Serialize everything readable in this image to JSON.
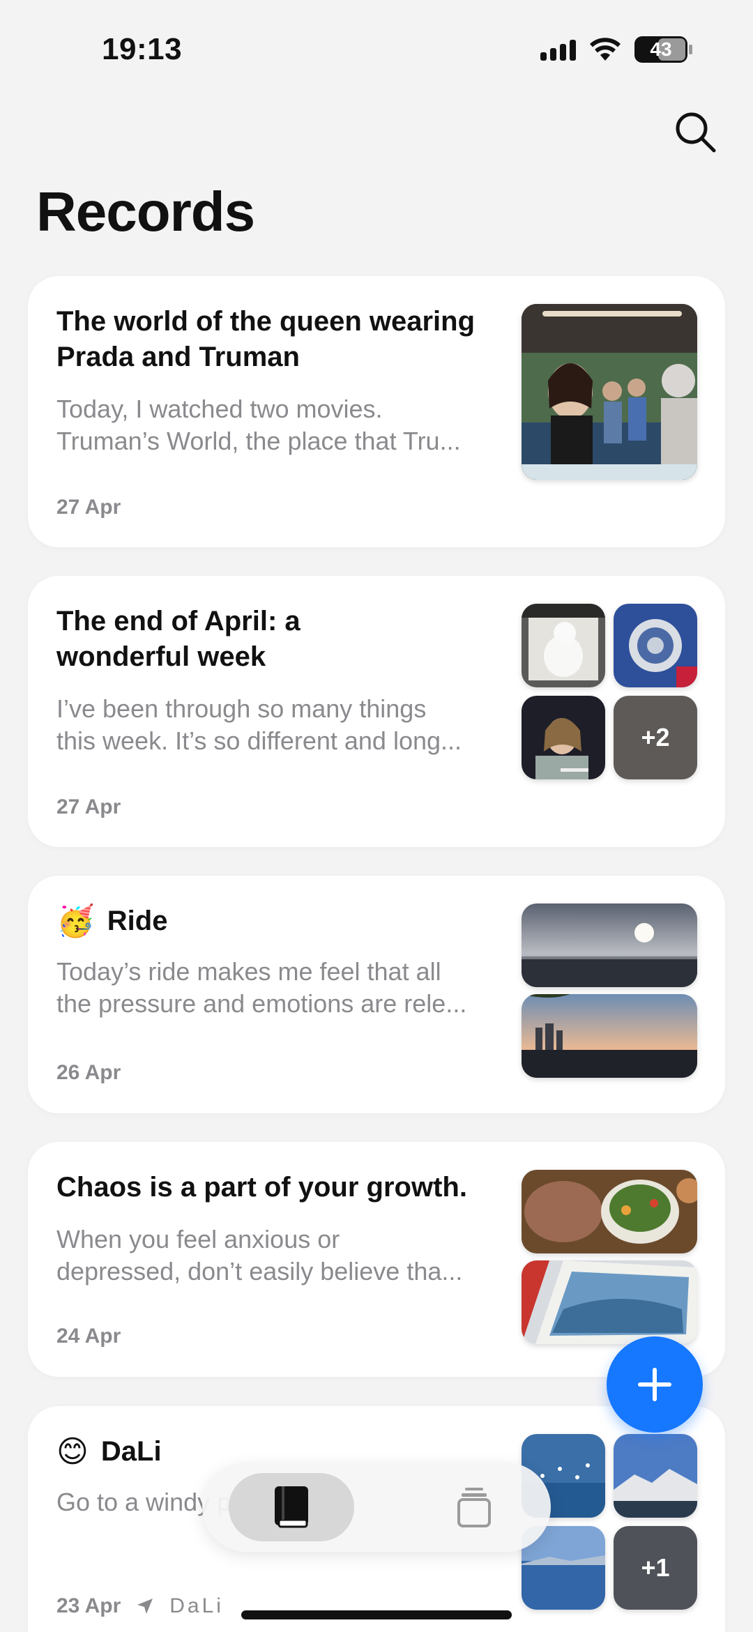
{
  "status_bar": {
    "time": "19:13",
    "battery": "43"
  },
  "header": {
    "title": "Records",
    "search_icon": "search-icon"
  },
  "records": [
    {
      "title_lines": [
        "The world of the queen wearing",
        "Prada and Truman"
      ],
      "body_lines": [
        "Today, I watched two movies.",
        "Truman’s World, the place that Tru..."
      ],
      "date": "27 Apr"
    },
    {
      "title_lines": [
        "The end of April: a",
        "wonderful week"
      ],
      "body_lines": [
        "I’ve been through so many things",
        "this week. It’s so different and long..."
      ],
      "date": "27 Apr",
      "more_count": "+2"
    },
    {
      "emoji": "🥳",
      "title": "Ride",
      "body_lines": [
        "Today’s ride makes me feel that all",
        "the pressure and emotions are rele..."
      ],
      "date": "26 Apr"
    },
    {
      "title": "Chaos is a part of your growth.",
      "body_lines": [
        "When you feel anxious or",
        "depressed, don’t easily believe tha..."
      ],
      "date": "24 Apr"
    },
    {
      "emoji": "😊",
      "title": "DaLi",
      "body_lines": [
        "Go to a windy place"
      ],
      "date": "23 Apr",
      "location": "DaLi",
      "more_count": "+1"
    }
  ],
  "fab": {
    "icon": "plus-icon"
  },
  "tab_bar": {
    "tabs": [
      {
        "icon": "book-icon",
        "active": true
      },
      {
        "icon": "stack-cards-icon",
        "active": false
      }
    ]
  }
}
